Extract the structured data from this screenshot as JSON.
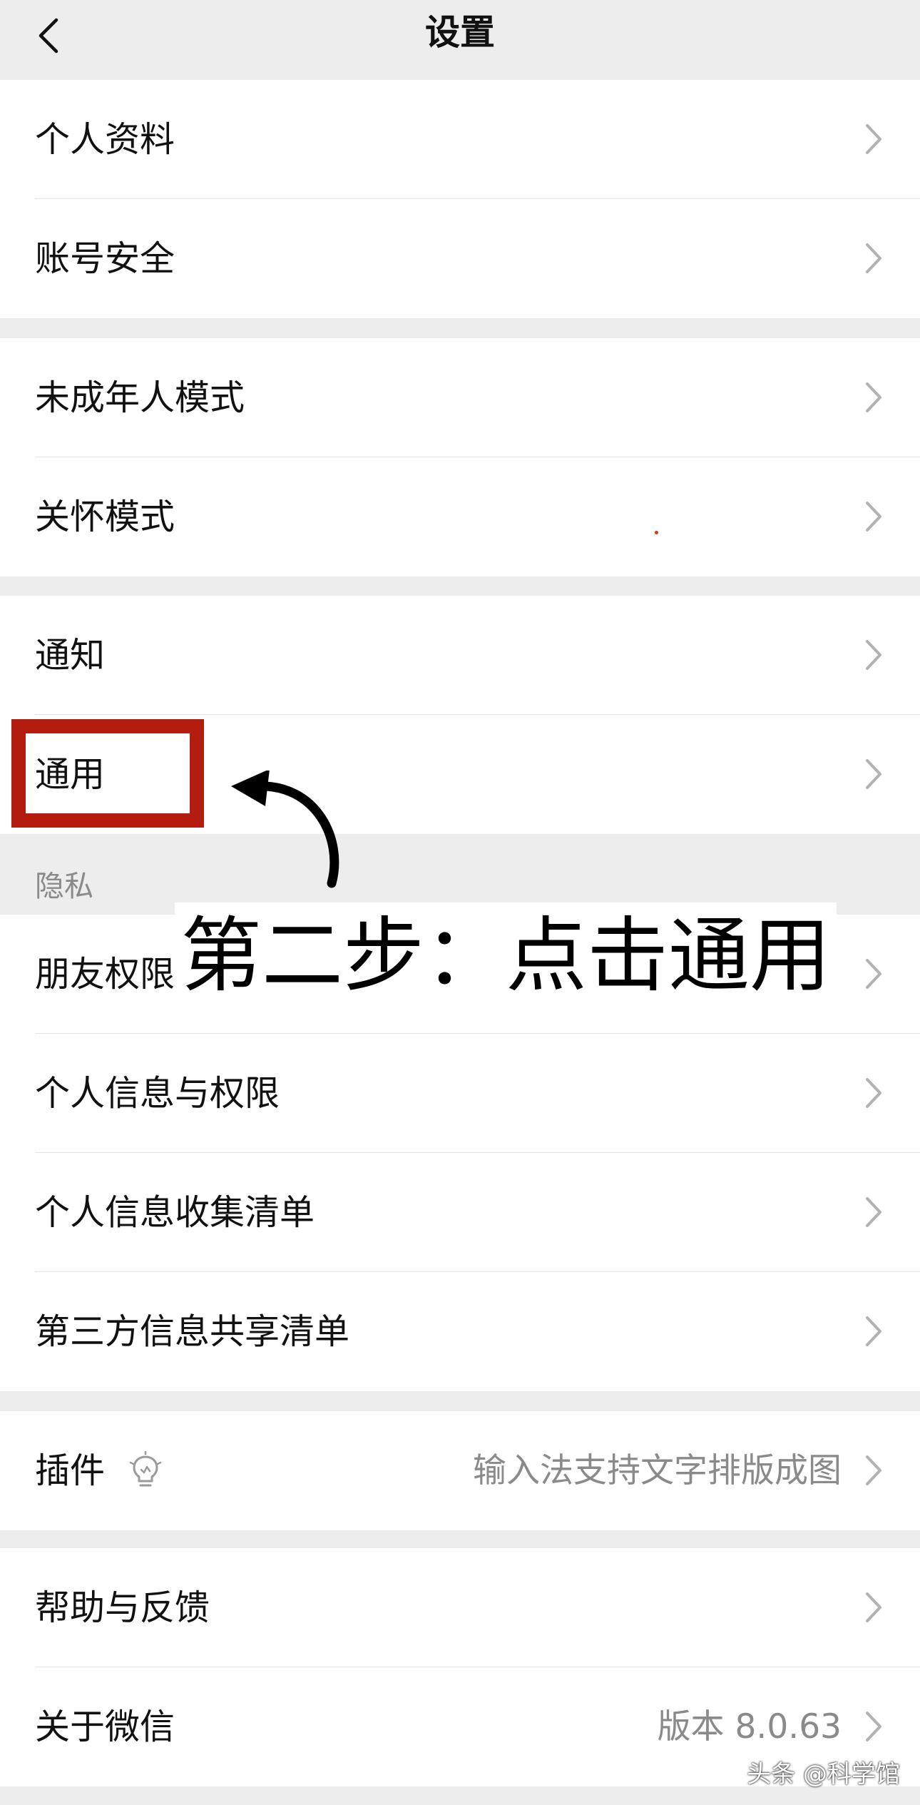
{
  "navbar": {
    "title": "设置",
    "back_icon": "chevron-left-icon"
  },
  "groups": [
    {
      "items": [
        {
          "label": "个人资料"
        },
        {
          "label": "账号安全"
        }
      ]
    },
    {
      "items": [
        {
          "label": "未成年人模式"
        },
        {
          "label": "关怀模式"
        }
      ]
    },
    {
      "items": [
        {
          "label": "通知"
        },
        {
          "label": "通用"
        }
      ]
    },
    {
      "header": "隐私",
      "items": [
        {
          "label": "朋友权限"
        },
        {
          "label": "个人信息与权限"
        },
        {
          "label": "个人信息收集清单"
        },
        {
          "label": "第三方信息共享清单"
        }
      ]
    },
    {
      "items": [
        {
          "label": "插件",
          "value": "输入法支持文字排版成图",
          "icon": "lightbulb-icon"
        }
      ]
    },
    {
      "items": [
        {
          "label": "帮助与反馈"
        },
        {
          "label": "关于微信",
          "value": "版本 8.0.63"
        }
      ]
    }
  ],
  "annotation": {
    "text": "第二步：点击通用",
    "highlight_color": "#b51c10"
  },
  "watermark": "头条 @科学馆"
}
